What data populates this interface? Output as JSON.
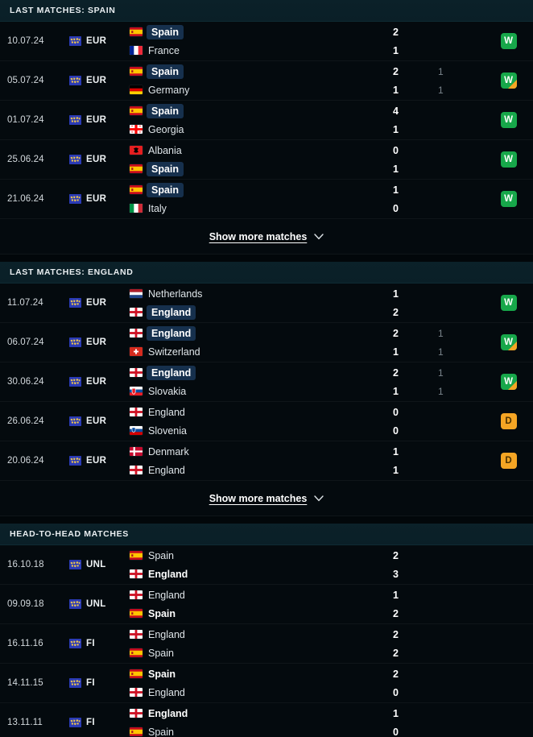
{
  "theme": {
    "page_bg": "#02070a",
    "row_bg": "#040a0e",
    "header_bg": "#0b2129",
    "winner_highlight": "#16304d",
    "win_color": "#17a74a",
    "draw_color": "#f5a524",
    "loss_color": "#d93a3a",
    "text_primary": "#e8ecef",
    "text_muted": "#7a858c"
  },
  "sections": [
    {
      "id": "last-matches-spain",
      "title": "LAST MATCHES: SPAIN",
      "show_more": {
        "label": "Show more matches",
        "icon": "chevron-down-icon"
      },
      "matches": [
        {
          "date": "10.07.24",
          "competition": {
            "code": "EUR",
            "icon": "euro-competition-icon"
          },
          "home": {
            "name": "Spain",
            "flag": "es",
            "winner": true
          },
          "away": {
            "name": "France",
            "flag": "fr",
            "winner": false
          },
          "score": {
            "home": "2",
            "away": "1"
          },
          "score2": {
            "home": "",
            "away": ""
          },
          "result": {
            "letter": "W",
            "type": "w",
            "extra": false
          }
        },
        {
          "date": "05.07.24",
          "competition": {
            "code": "EUR",
            "icon": "euro-competition-icon"
          },
          "home": {
            "name": "Spain",
            "flag": "es",
            "winner": true
          },
          "away": {
            "name": "Germany",
            "flag": "de",
            "winner": false
          },
          "score": {
            "home": "2",
            "away": "1"
          },
          "score2": {
            "home": "1",
            "away": "1"
          },
          "result": {
            "letter": "W",
            "type": "w",
            "extra": true
          }
        },
        {
          "date": "01.07.24",
          "competition": {
            "code": "EUR",
            "icon": "euro-competition-icon"
          },
          "home": {
            "name": "Spain",
            "flag": "es",
            "winner": true
          },
          "away": {
            "name": "Georgia",
            "flag": "ge",
            "winner": false
          },
          "score": {
            "home": "4",
            "away": "1"
          },
          "score2": {
            "home": "",
            "away": ""
          },
          "result": {
            "letter": "W",
            "type": "w",
            "extra": false
          }
        },
        {
          "date": "25.06.24",
          "competition": {
            "code": "EUR",
            "icon": "euro-competition-icon"
          },
          "home": {
            "name": "Albania",
            "flag": "al",
            "winner": false
          },
          "away": {
            "name": "Spain",
            "flag": "es",
            "winner": true
          },
          "score": {
            "home": "0",
            "away": "1"
          },
          "score2": {
            "home": "",
            "away": ""
          },
          "result": {
            "letter": "W",
            "type": "w",
            "extra": false
          }
        },
        {
          "date": "21.06.24",
          "competition": {
            "code": "EUR",
            "icon": "euro-competition-icon"
          },
          "home": {
            "name": "Spain",
            "flag": "es",
            "winner": true
          },
          "away": {
            "name": "Italy",
            "flag": "it",
            "winner": false
          },
          "score": {
            "home": "1",
            "away": "0"
          },
          "score2": {
            "home": "",
            "away": ""
          },
          "result": {
            "letter": "W",
            "type": "w",
            "extra": false
          }
        }
      ]
    },
    {
      "id": "last-matches-england",
      "title": "LAST MATCHES: ENGLAND",
      "show_more": {
        "label": "Show more matches",
        "icon": "chevron-down-icon"
      },
      "matches": [
        {
          "date": "11.07.24",
          "competition": {
            "code": "EUR",
            "icon": "euro-competition-icon"
          },
          "home": {
            "name": "Netherlands",
            "flag": "nl",
            "winner": false
          },
          "away": {
            "name": "England",
            "flag": "en",
            "winner": true
          },
          "score": {
            "home": "1",
            "away": "2"
          },
          "score2": {
            "home": "",
            "away": ""
          },
          "result": {
            "letter": "W",
            "type": "w",
            "extra": false
          }
        },
        {
          "date": "06.07.24",
          "competition": {
            "code": "EUR",
            "icon": "euro-competition-icon"
          },
          "home": {
            "name": "England",
            "flag": "en",
            "winner": true
          },
          "away": {
            "name": "Switzerland",
            "flag": "ch",
            "winner": false
          },
          "score": {
            "home": "2",
            "away": "1"
          },
          "score2": {
            "home": "1",
            "away": "1"
          },
          "result": {
            "letter": "W",
            "type": "w",
            "extra": true
          }
        },
        {
          "date": "30.06.24",
          "competition": {
            "code": "EUR",
            "icon": "euro-competition-icon"
          },
          "home": {
            "name": "England",
            "flag": "en",
            "winner": true
          },
          "away": {
            "name": "Slovakia",
            "flag": "sk",
            "winner": false
          },
          "score": {
            "home": "2",
            "away": "1"
          },
          "score2": {
            "home": "1",
            "away": "1"
          },
          "result": {
            "letter": "W",
            "type": "w",
            "extra": true
          }
        },
        {
          "date": "26.06.24",
          "competition": {
            "code": "EUR",
            "icon": "euro-competition-icon"
          },
          "home": {
            "name": "England",
            "flag": "en",
            "winner": false
          },
          "away": {
            "name": "Slovenia",
            "flag": "si",
            "winner": false
          },
          "score": {
            "home": "0",
            "away": "0"
          },
          "score2": {
            "home": "",
            "away": ""
          },
          "result": {
            "letter": "D",
            "type": "d",
            "extra": false
          }
        },
        {
          "date": "20.06.24",
          "competition": {
            "code": "EUR",
            "icon": "euro-competition-icon"
          },
          "home": {
            "name": "Denmark",
            "flag": "dk",
            "winner": false
          },
          "away": {
            "name": "England",
            "flag": "en",
            "winner": false
          },
          "score": {
            "home": "1",
            "away": "1"
          },
          "score2": {
            "home": "",
            "away": ""
          },
          "result": {
            "letter": "D",
            "type": "d",
            "extra": false
          }
        }
      ]
    },
    {
      "id": "head-to-head-matches",
      "title": "HEAD-TO-HEAD MATCHES",
      "show_more": null,
      "matches": [
        {
          "date": "16.10.18",
          "competition": {
            "code": "UNL",
            "icon": "euro-competition-icon"
          },
          "home": {
            "name": "Spain",
            "flag": "es",
            "winner": false
          },
          "away": {
            "name": "England",
            "flag": "en",
            "winner": true
          },
          "score": {
            "home": "2",
            "away": "3"
          },
          "score2": {
            "home": "",
            "away": ""
          },
          "result": null
        },
        {
          "date": "09.09.18",
          "competition": {
            "code": "UNL",
            "icon": "euro-competition-icon"
          },
          "home": {
            "name": "England",
            "flag": "en",
            "winner": false
          },
          "away": {
            "name": "Spain",
            "flag": "es",
            "winner": true
          },
          "score": {
            "home": "1",
            "away": "2"
          },
          "score2": {
            "home": "",
            "away": ""
          },
          "result": null
        },
        {
          "date": "16.11.16",
          "competition": {
            "code": "FI",
            "icon": "euro-competition-icon"
          },
          "home": {
            "name": "England",
            "flag": "en",
            "winner": false
          },
          "away": {
            "name": "Spain",
            "flag": "es",
            "winner": false
          },
          "score": {
            "home": "2",
            "away": "2"
          },
          "score2": {
            "home": "",
            "away": ""
          },
          "result": null
        },
        {
          "date": "14.11.15",
          "competition": {
            "code": "FI",
            "icon": "euro-competition-icon"
          },
          "home": {
            "name": "Spain",
            "flag": "es",
            "winner": true
          },
          "away": {
            "name": "England",
            "flag": "en",
            "winner": false
          },
          "score": {
            "home": "2",
            "away": "0"
          },
          "score2": {
            "home": "",
            "away": ""
          },
          "result": null
        },
        {
          "date": "13.11.11",
          "competition": {
            "code": "FI",
            "icon": "euro-competition-icon"
          },
          "home": {
            "name": "England",
            "flag": "en",
            "winner": true
          },
          "away": {
            "name": "Spain",
            "flag": "es",
            "winner": false
          },
          "score": {
            "home": "1",
            "away": "0"
          },
          "score2": {
            "home": "",
            "away": ""
          },
          "result": null
        }
      ]
    }
  ]
}
